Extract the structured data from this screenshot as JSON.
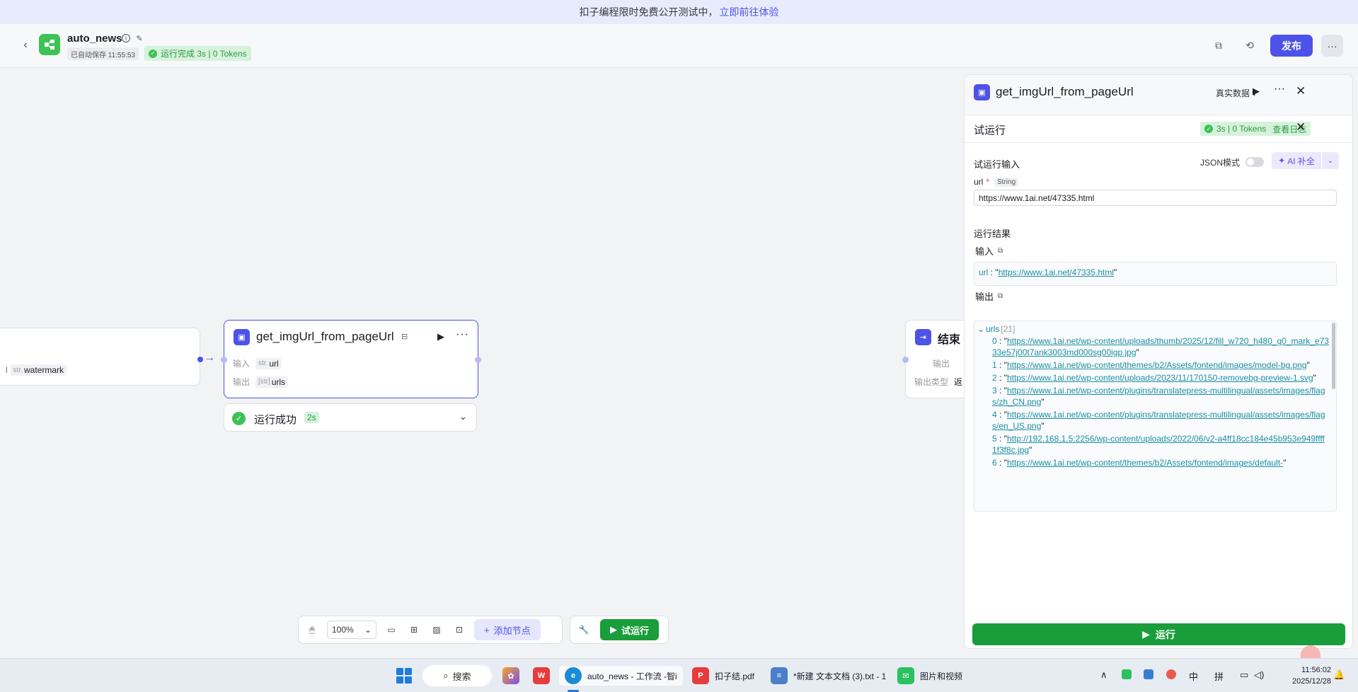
{
  "banner": {
    "text": "扣子编程限时免费公开测试中，",
    "link": "立即前往体验"
  },
  "header": {
    "app_name": "auto_news",
    "autosave": "已自动保存 11:55:53",
    "run_status": "运行完成 3s | 0 Tokens",
    "publish_label": "发布",
    "more_label": "···"
  },
  "left_node": {
    "param_type": "str.",
    "param_name": "watermark",
    "prefix": "l"
  },
  "main_node": {
    "title": "get_imgUrl_from_pageUrl",
    "input_label": "输入",
    "input_type": "str.",
    "input_name": "url",
    "output_label": "输出",
    "output_type": "[str]",
    "output_name": "urls",
    "run_text": "运行成功",
    "run_duration": "2s"
  },
  "end_node": {
    "title": "结束",
    "output_label": "输出",
    "output_type_label": "输出类型",
    "output_type_value": "返"
  },
  "toolbar": {
    "zoom": "100%",
    "add_node": "添加节点",
    "trial_run": "试运行"
  },
  "panel": {
    "title": "get_imgUrl_from_pageUrl",
    "data_mode": "真实数据",
    "trial_title": "试运行",
    "trial_badge": "3s | 0 Tokens",
    "trial_log": "查看日志",
    "input_section": "试运行输入",
    "json_mode": "JSON模式",
    "ai_fill": "AI 补全",
    "field_name": "url",
    "field_type": "String",
    "field_value": "https://www.1ai.net/47335.html",
    "result_section": "运行结果",
    "input_head": "输入",
    "input_key": "url",
    "input_value": "https://www.1ai.net/47335.html",
    "output_head": "输出",
    "output_key": "urls",
    "output_count": "[21]",
    "output_items": [
      {
        "idx": "0",
        "url": "https://www.1ai.net/wp-content/uploads/thumb/2025/12/fill_w720_h480_g0_mark_e7333e57j00t7ank3003md000sg00igp.jpg"
      },
      {
        "idx": "1",
        "url": "https://www.1ai.net/wp-content/themes/b2/Assets/fontend/images/model-bg.png"
      },
      {
        "idx": "2",
        "url": "https://www.1ai.net/wp-content/uploads/2023/11/170150-removebg-preview-1.svg"
      },
      {
        "idx": "3",
        "url": "https://www.1ai.net/wp-content/plugins/translatepress-multilingual/assets/images/flags/zh_CN.png"
      },
      {
        "idx": "4",
        "url": "https://www.1ai.net/wp-content/plugins/translatepress-multilingual/assets/images/flags/en_US.png"
      },
      {
        "idx": "5",
        "url": "http://192.168.1.5:2256/wp-content/uploads/2022/06/v2-a4ff18cc184e45b953e949ffff1f3f8c.jpg"
      },
      {
        "idx": "6",
        "url": "https://www.1ai.net/wp-content/themes/b2/Assets/fontend/images/default-"
      }
    ],
    "run_button": "运行"
  },
  "taskbar": {
    "search": "搜索",
    "edge_label": "auto_news - 工作流 -智i",
    "pdf_label": "扣子结.pdf",
    "notepad_label": "*新建 文本文档 (3).txt - 1",
    "wechat_label": "图片和视频",
    "ime1": "中",
    "ime2": "拼",
    "time": "11:56:02",
    "date": "2025/12/28"
  }
}
